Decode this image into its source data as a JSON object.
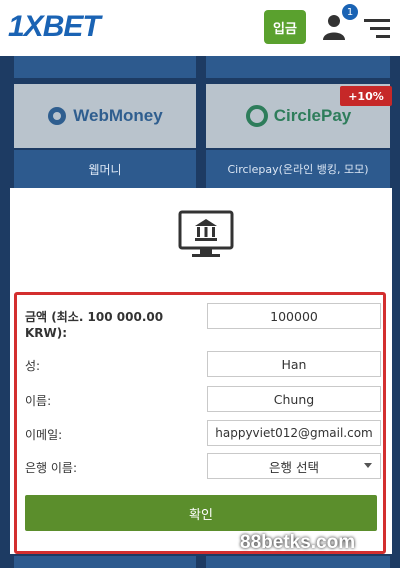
{
  "header": {
    "logo": "1XBET",
    "deposit_label": "입금",
    "notification_count": "1"
  },
  "payments": {
    "webmoney_logo": "WebMoney",
    "webmoney_caption": "웹머니",
    "circlepay_logo": "CirclePay",
    "circlepay_caption": "Circlepay(온라인 뱅킹, 모모)",
    "circlepay_promo": "+10%"
  },
  "form": {
    "amount_label": "금액 (최소. 100 000.00 KRW):",
    "amount_value": "100000",
    "last_name_label": "성:",
    "last_name_value": "Han",
    "first_name_label": "이름:",
    "first_name_value": "Chung",
    "email_label": "이메일:",
    "email_value": "happyviet012@gmail.com",
    "bank_label": "은행 이름:",
    "bank_value": "은행 선택",
    "confirm_label": "확인"
  },
  "watermark": "88betks.com",
  "colors": {
    "brand_blue": "#1a63b4",
    "background": "#1d3b63",
    "deposit_green": "#5aa12e",
    "confirm_green": "#5b8e2c",
    "highlight_red": "#d32f2f"
  }
}
